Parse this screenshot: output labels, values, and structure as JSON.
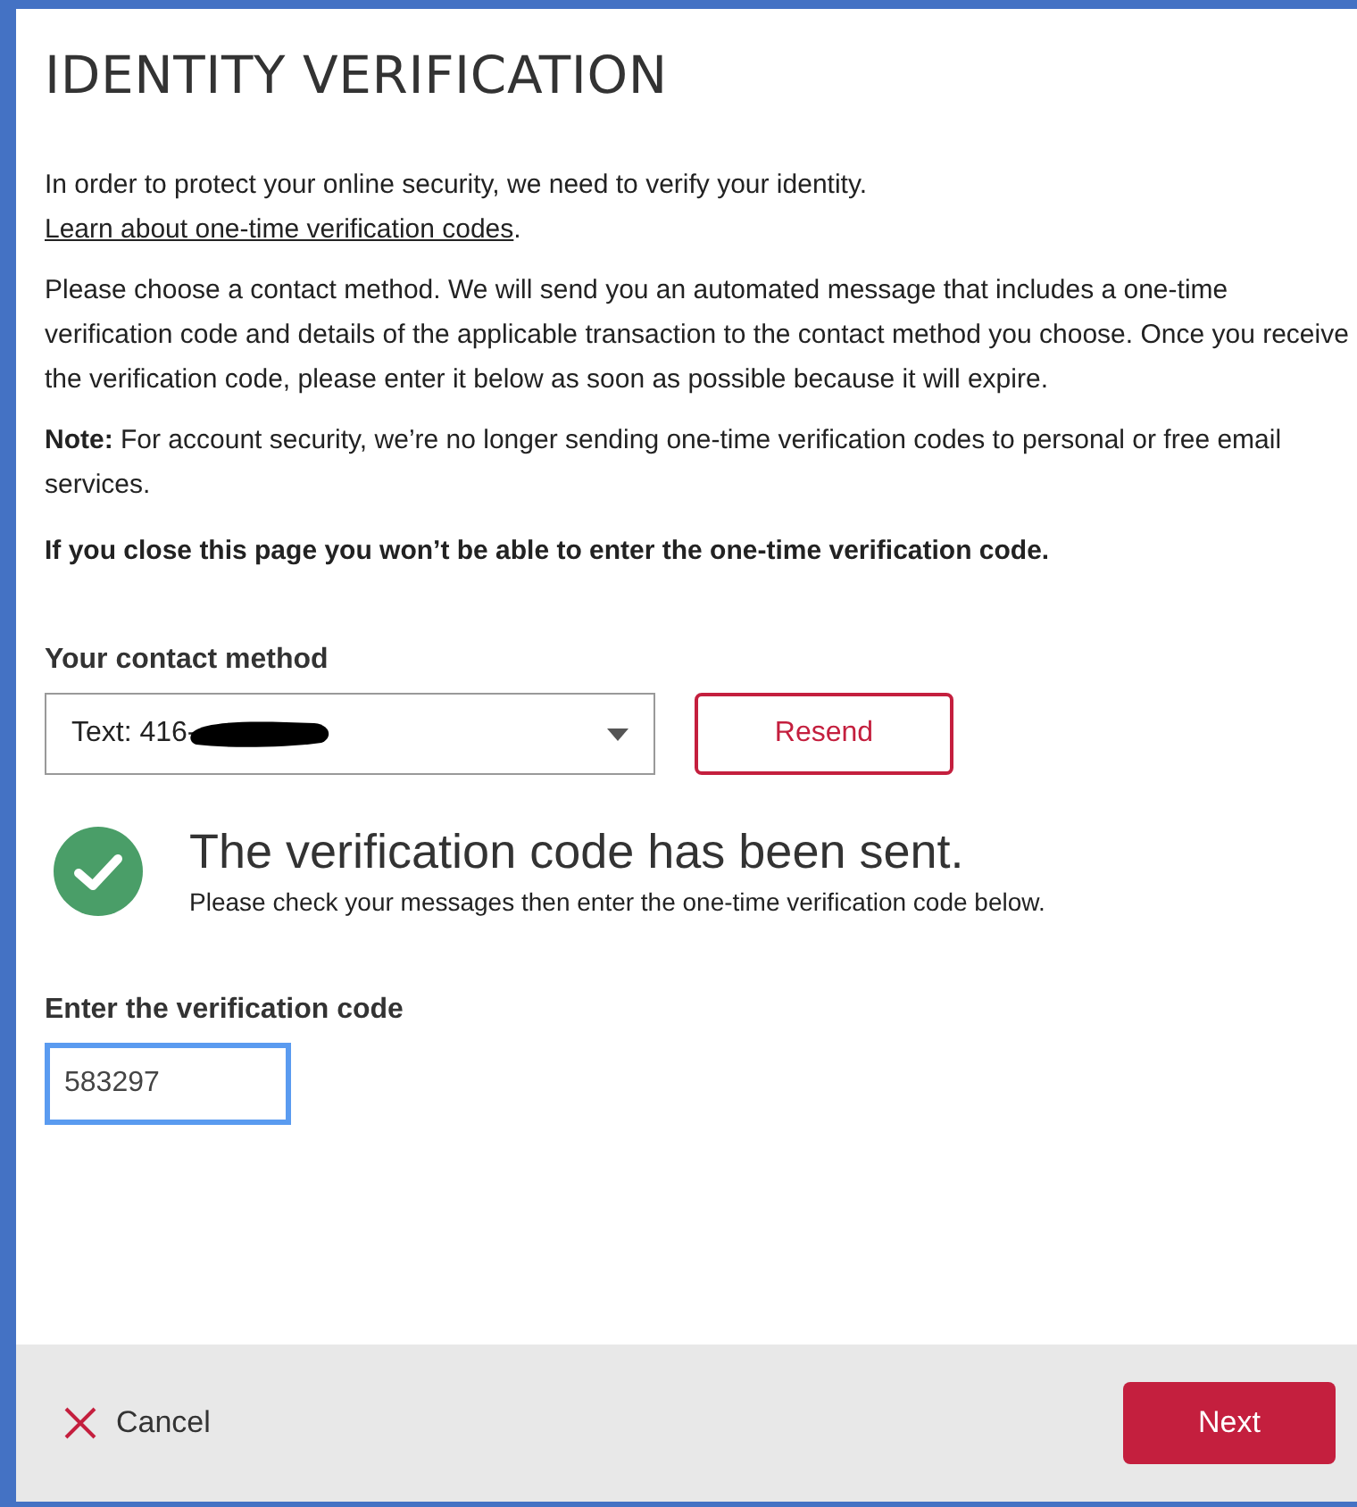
{
  "title": "IDENTITY VERIFICATION",
  "intro": {
    "text": "In order to protect your online security, we need to verify your identity.",
    "link": "Learn about one-time verification codes",
    "after": "."
  },
  "paragraphs": [
    {
      "kind": "plain",
      "text": "Please choose a contact method. We will send you an automated message that includes a one-time verification code and details of the applicable transaction to the contact method you choose. Once you receive the verification code, please enter it below as soon as possible because it will expire."
    },
    {
      "kind": "plain",
      "text": "**Note:** For account security, we’re no longer sending one-time verification codes to personal or free email services."
    },
    {
      "kind": "strong",
      "text": "If you close this page you won’t be able to enter the one-time verification code."
    }
  ],
  "contact": {
    "label": "Your contact method",
    "value": "Text: 416-",
    "redacted": true,
    "resend": "Resend"
  },
  "status": {
    "kind": "success",
    "heading": "The verification code has been sent.",
    "message": "Please check your messages then enter the one-time verification code below."
  },
  "code": {
    "label": "Enter the verification code",
    "value": "583297",
    "focused": true
  },
  "footer": {
    "cancel": "Cancel",
    "next": "Next"
  }
}
